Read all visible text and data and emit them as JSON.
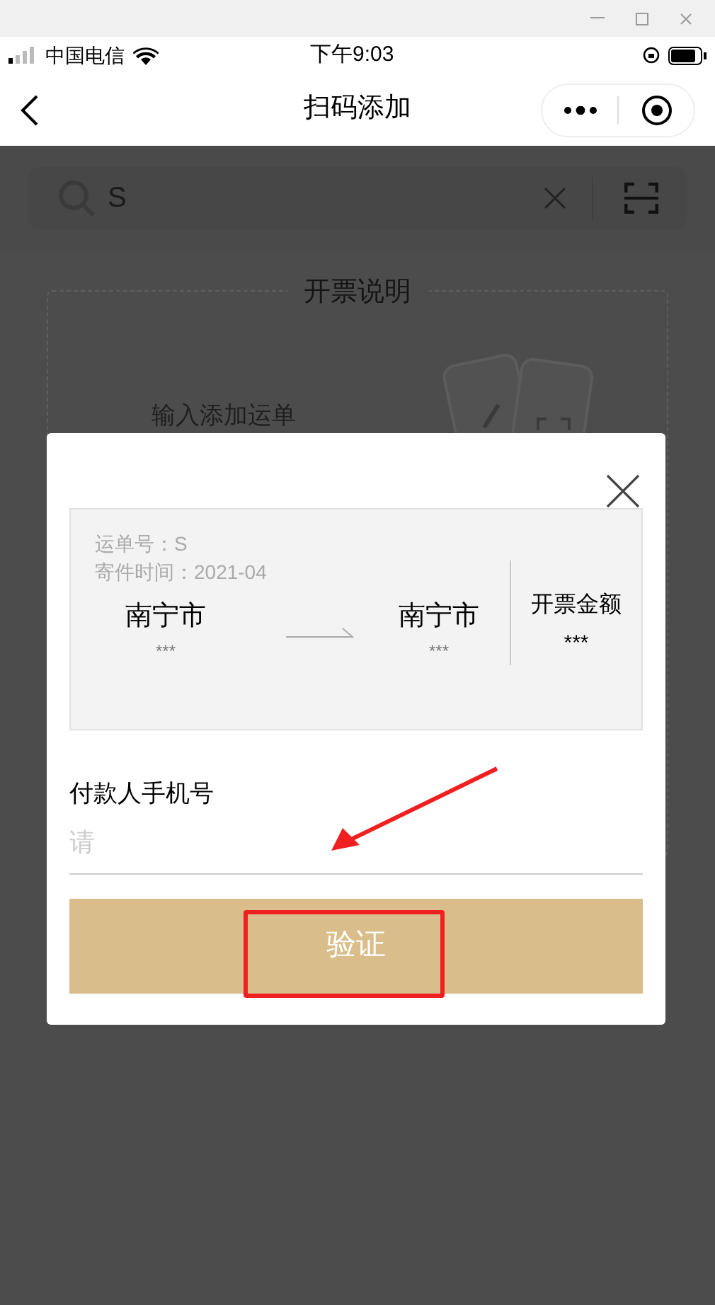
{
  "status_bar": {
    "carrier": "中国电信",
    "time": "下午9:03"
  },
  "nav": {
    "title": "扫码添加"
  },
  "search": {
    "value": "S"
  },
  "guide": {
    "title": "开票说明",
    "item": "输入添加运单"
  },
  "dialog": {
    "waybill": "运单号：S",
    "sent_time": "寄件时间：2021-04",
    "origin": {
      "city": "南宁市",
      "detail": "***"
    },
    "destination": {
      "city": "南宁市",
      "detail": "***"
    },
    "amount_label": "开票金额",
    "amount": "***",
    "phone_label": "付款人手机号",
    "phone_placeholder": "请",
    "button": "验证"
  }
}
